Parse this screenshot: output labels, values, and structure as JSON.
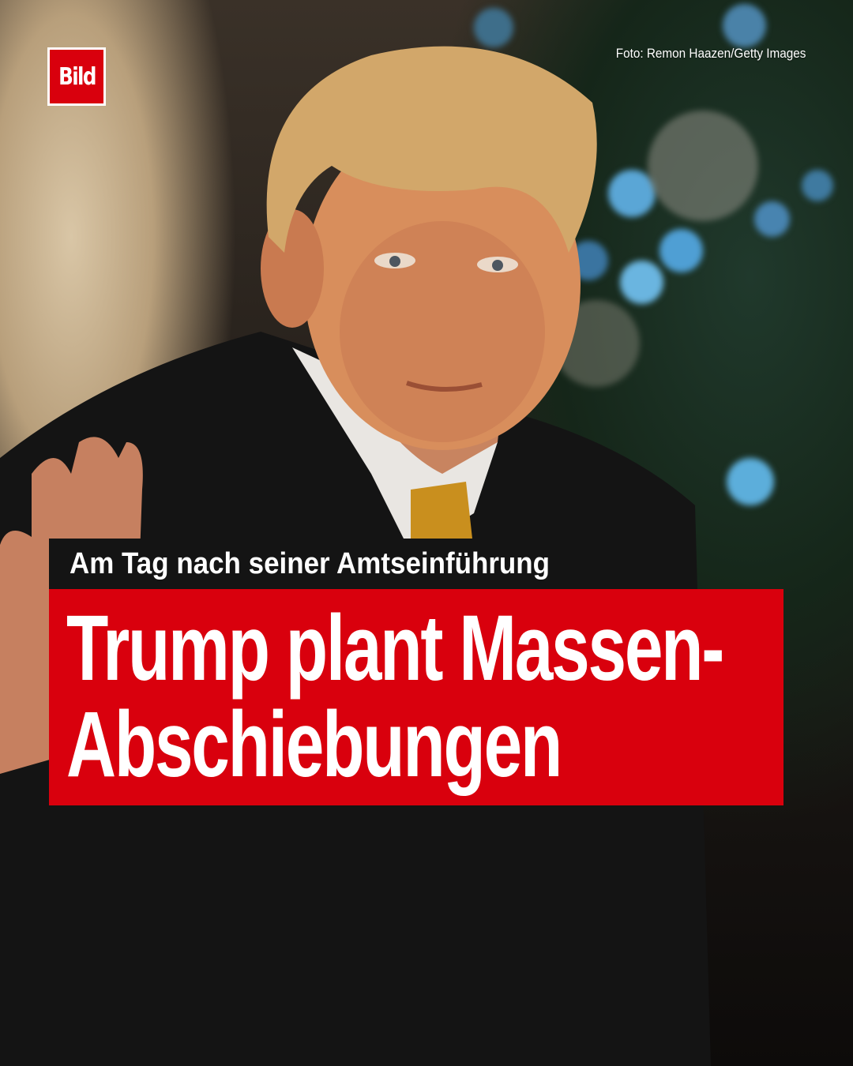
{
  "brand": {
    "logo_text": "Bild",
    "color": "#d9000d"
  },
  "photo_credit": "Foto: Remon Haazen/Getty Images",
  "kicker": "Am Tag nach seiner Amtseinführung",
  "headline": {
    "line1": "Trump plant Massen-",
    "line2": "Abschiebungen"
  }
}
